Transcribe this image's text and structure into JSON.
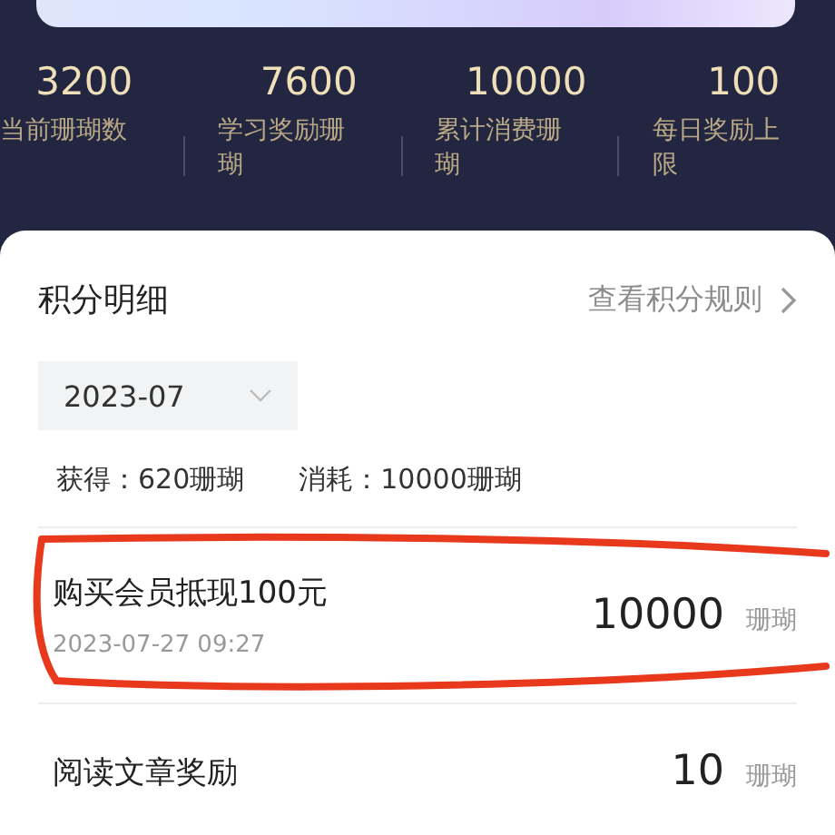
{
  "stats": [
    {
      "value": "3200",
      "label": "当前珊瑚数"
    },
    {
      "value": "7600",
      "label": "学习奖励珊瑚"
    },
    {
      "value": "10000",
      "label": "累计消费珊瑚"
    },
    {
      "value": "100",
      "label": "每日奖励上限"
    }
  ],
  "details": {
    "title": "积分明细",
    "rules_link": "查看积分规则",
    "month": "2023-07",
    "earned": "获得：620珊瑚",
    "spent": "消耗：10000珊瑚"
  },
  "records": [
    {
      "title": "购买会员抵现100元",
      "time": "2023-07-27 09:27",
      "amount": "10000",
      "unit": "珊瑚",
      "circled": true
    },
    {
      "title": "阅读文章奖励",
      "amount": "10",
      "unit": "珊瑚",
      "circled": false
    }
  ]
}
